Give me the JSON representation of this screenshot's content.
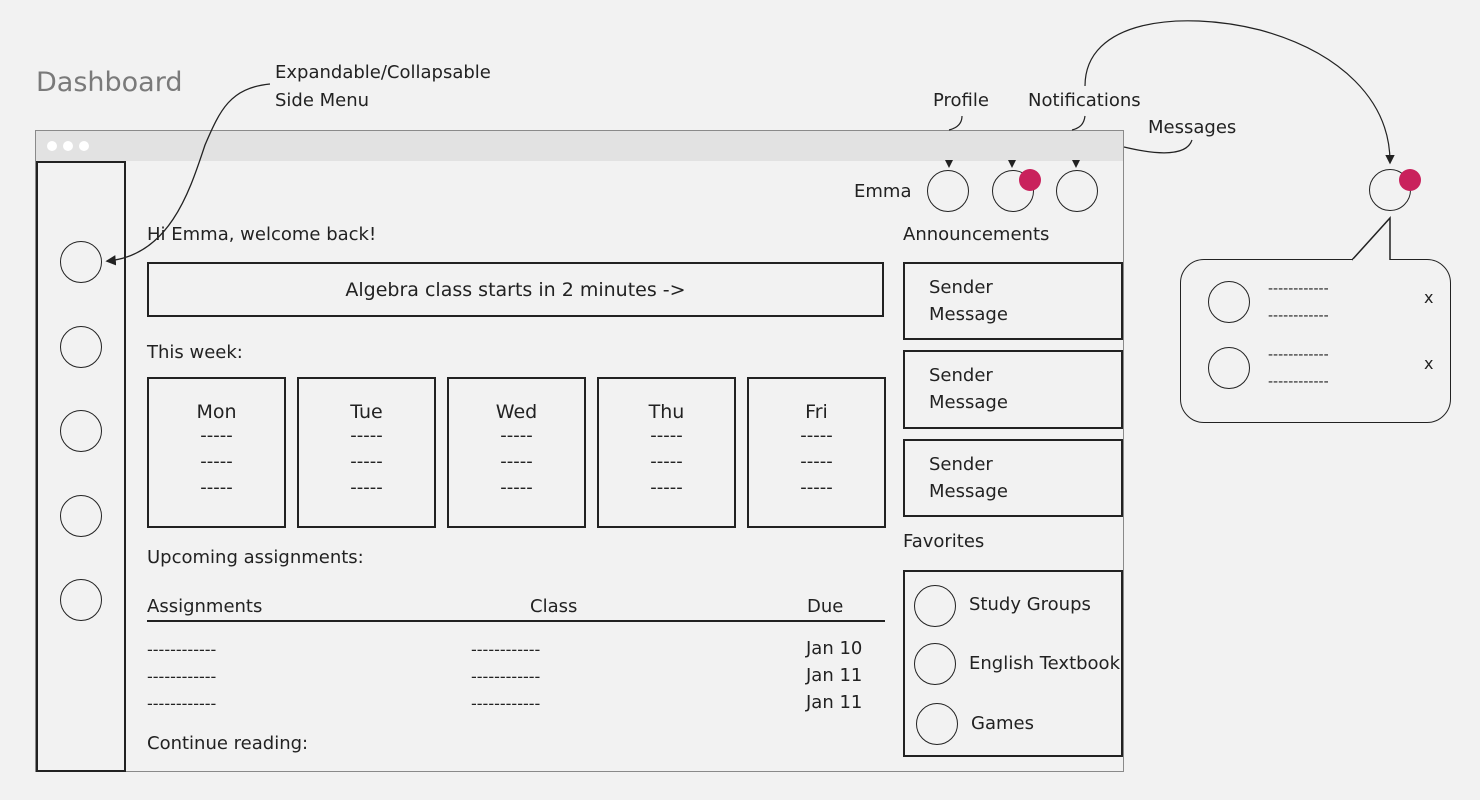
{
  "page_heading": "Dashboard",
  "annotations": {
    "side_menu_line1": "Expandable/Collapsable",
    "side_menu_line2": "Side Menu",
    "profile": "Profile",
    "notifications": "Notifications",
    "messages": "Messages"
  },
  "header": {
    "user_name": "Emma"
  },
  "main": {
    "greeting": "Hi Emma, welcome back!",
    "class_banner": "Algebra class starts in 2 minutes ->",
    "week_title": "This week:",
    "days": [
      {
        "name": "Mon",
        "lines": [
          "-----",
          "-----",
          "-----"
        ]
      },
      {
        "name": "Tue",
        "lines": [
          "-----",
          "-----",
          "-----"
        ]
      },
      {
        "name": "Wed",
        "lines": [
          "-----",
          "-----",
          "-----"
        ]
      },
      {
        "name": "Thu",
        "lines": [
          "-----",
          "-----",
          "-----"
        ]
      },
      {
        "name": "Fri",
        "lines": [
          "-----",
          "-----",
          "-----"
        ]
      }
    ],
    "assignments_title": "Upcoming assignments:",
    "assignments_table": {
      "headers": [
        "Assignments",
        "Class",
        "Due"
      ],
      "rows": [
        {
          "assignment": "------------",
          "class": "------------",
          "due": "Jan 10"
        },
        {
          "assignment": "------------",
          "class": "------------",
          "due": "Jan 11"
        },
        {
          "assignment": "------------",
          "class": "------------",
          "due": "Jan 11"
        }
      ]
    },
    "continue_reading": "Continue reading:"
  },
  "right_panel": {
    "announcements_title": "Announcements",
    "announcements": [
      {
        "sender": "Sender",
        "message": "Message"
      },
      {
        "sender": "Sender",
        "message": "Message"
      },
      {
        "sender": "Sender",
        "message": "Message"
      }
    ],
    "favorites_title": "Favorites",
    "favorites": [
      "Study Groups",
      "English Textbook",
      "Games"
    ]
  },
  "notification_popup": {
    "items": [
      {
        "line1": "------------",
        "line2": "------------",
        "close": "x"
      },
      {
        "line1": "------------",
        "line2": "------------",
        "close": "x"
      }
    ]
  },
  "colors": {
    "background": "#f2f2f2",
    "notification_badge": "#c9215c",
    "heading_gray": "#7a7a7a"
  }
}
